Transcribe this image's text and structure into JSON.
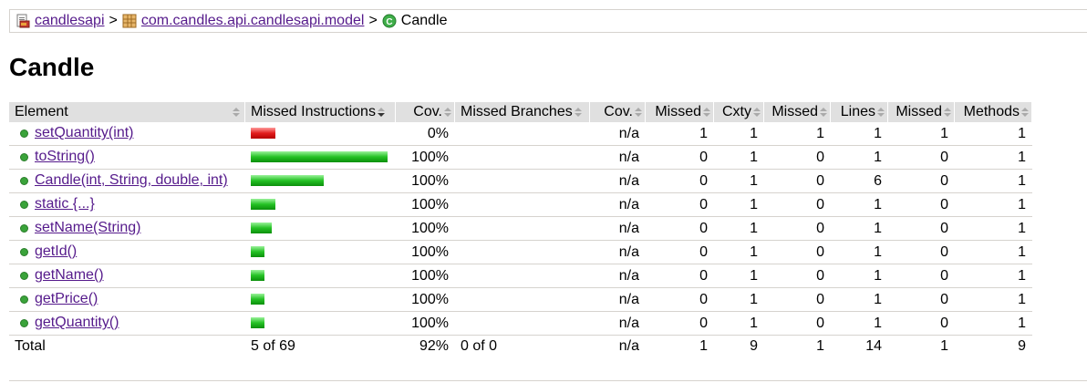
{
  "breadcrumb": {
    "project": "candlesapi",
    "package": "com.candles.api.candlesapi.model",
    "class": "Candle",
    "separator": ">"
  },
  "page_title": "Candle",
  "table": {
    "headers": {
      "element": "Element",
      "missed_instructions": "Missed Instructions",
      "cov_instr": "Cov.",
      "missed_branches": "Missed Branches",
      "cov_branch": "Cov.",
      "missed_cxty": "Missed",
      "cxty": "Cxty",
      "missed_lines": "Missed",
      "lines": "Lines",
      "missed_methods": "Missed",
      "methods": "Methods"
    },
    "rows": [
      {
        "element": "setQuantity(int)",
        "bar_color": "red",
        "bar_fraction": 0.18,
        "cov": "0%",
        "cov_branch": "n/a",
        "missed_cxty": "1",
        "cxty": "1",
        "missed_lines": "1",
        "lines": "1",
        "missed_methods": "1",
        "methods": "1"
      },
      {
        "element": "toString()",
        "bar_color": "green",
        "bar_fraction": 1.0,
        "cov": "100%",
        "cov_branch": "n/a",
        "missed_cxty": "0",
        "cxty": "1",
        "missed_lines": "0",
        "lines": "1",
        "missed_methods": "0",
        "methods": "1"
      },
      {
        "element": "Candle(int, String, double, int)",
        "bar_color": "green",
        "bar_fraction": 0.53,
        "cov": "100%",
        "cov_branch": "n/a",
        "missed_cxty": "0",
        "cxty": "1",
        "missed_lines": "0",
        "lines": "6",
        "missed_methods": "0",
        "methods": "1"
      },
      {
        "element": "static {...}",
        "bar_color": "green",
        "bar_fraction": 0.18,
        "cov": "100%",
        "cov_branch": "n/a",
        "missed_cxty": "0",
        "cxty": "1",
        "missed_lines": "0",
        "lines": "1",
        "missed_methods": "0",
        "methods": "1"
      },
      {
        "element": "setName(String)",
        "bar_color": "green",
        "bar_fraction": 0.15,
        "cov": "100%",
        "cov_branch": "n/a",
        "missed_cxty": "0",
        "cxty": "1",
        "missed_lines": "0",
        "lines": "1",
        "missed_methods": "0",
        "methods": "1"
      },
      {
        "element": "getId()",
        "bar_color": "green",
        "bar_fraction": 0.1,
        "cov": "100%",
        "cov_branch": "n/a",
        "missed_cxty": "0",
        "cxty": "1",
        "missed_lines": "0",
        "lines": "1",
        "missed_methods": "0",
        "methods": "1"
      },
      {
        "element": "getName()",
        "bar_color": "green",
        "bar_fraction": 0.1,
        "cov": "100%",
        "cov_branch": "n/a",
        "missed_cxty": "0",
        "cxty": "1",
        "missed_lines": "0",
        "lines": "1",
        "missed_methods": "0",
        "methods": "1"
      },
      {
        "element": "getPrice()",
        "bar_color": "green",
        "bar_fraction": 0.1,
        "cov": "100%",
        "cov_branch": "n/a",
        "missed_cxty": "0",
        "cxty": "1",
        "missed_lines": "0",
        "lines": "1",
        "missed_methods": "0",
        "methods": "1"
      },
      {
        "element": "getQuantity()",
        "bar_color": "green",
        "bar_fraction": 0.1,
        "cov": "100%",
        "cov_branch": "n/a",
        "missed_cxty": "0",
        "cxty": "1",
        "missed_lines": "0",
        "lines": "1",
        "missed_methods": "0",
        "methods": "1"
      }
    ],
    "total": {
      "label": "Total",
      "missed_instructions": "5 of 69",
      "cov": "92%",
      "missed_branches": "0 of 0",
      "cov_branch": "n/a",
      "missed_cxty": "1",
      "cxty": "9",
      "missed_lines": "1",
      "lines": "14",
      "missed_methods": "1",
      "methods": "9"
    }
  },
  "colors": {
    "header_bg": "#e0e0e0",
    "link": "#551a8b",
    "bar_red": "#e21d1d",
    "bar_green": "#25c225",
    "dot_green": "#3aa33a"
  },
  "icons": {
    "project": "report-folder-icon",
    "package": "package-icon",
    "class": "class-icon",
    "method": "method-dot-icon",
    "sort_both": "sort-arrows-icon",
    "sort_down": "sort-descending-icon"
  }
}
